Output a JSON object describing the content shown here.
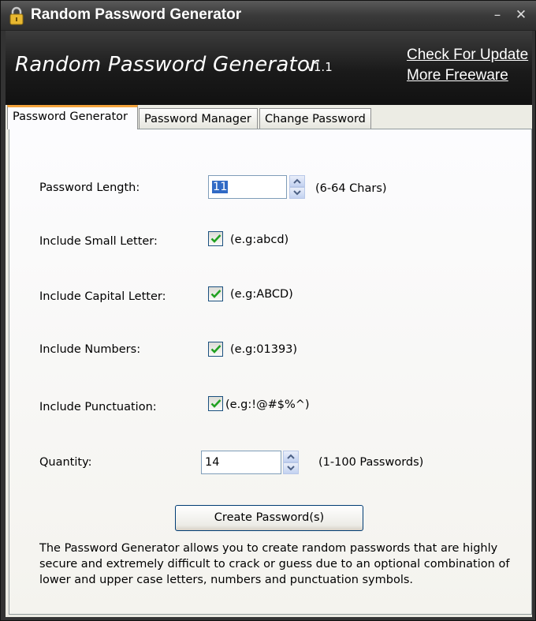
{
  "window": {
    "title": "Random Password Generator"
  },
  "banner": {
    "title": "Random Password Generator",
    "version": "v1.1",
    "links": {
      "check_update": "Check For Update",
      "more_freeware": "More Freeware"
    }
  },
  "tabs": [
    {
      "label": "Password Generator",
      "active": true
    },
    {
      "label": "Password Manager",
      "active": false
    },
    {
      "label": "Change Password",
      "active": false
    }
  ],
  "form": {
    "length": {
      "label": "Password Length:",
      "value": "11",
      "hint": "(6-64 Chars)"
    },
    "small": {
      "label": "Include Small Letter:",
      "checked": true,
      "hint": "(e.g:abcd)"
    },
    "capital": {
      "label": "Include Capital Letter:",
      "checked": true,
      "hint": "(e.g:ABCD)"
    },
    "numbers": {
      "label": "Include Numbers:",
      "checked": true,
      "hint": "(e.g:01393)"
    },
    "punctuation": {
      "label": "Include Punctuation:",
      "checked": true,
      "hint": "(e.g:!@#$%^)"
    },
    "quantity": {
      "label": "Quantity:",
      "value": "14",
      "hint": "(1-100 Passwords)"
    },
    "create_label": "Create Password(s)"
  },
  "description": "The Password Generator allows you to create random passwords that are highly secure and extremely difficult to crack or guess due to an optional combination of lower and upper case letters, numbers and punctuation symbols.",
  "icons": {
    "lock": "lock-icon",
    "minimize": "minimize-icon",
    "close": "close-icon",
    "check": "check-icon",
    "spin_up": "arrow-up-icon",
    "spin_down": "arrow-down-icon"
  },
  "colors": {
    "active_tab_accent": "#f3a33b",
    "check_mark": "#21a121",
    "selection": "#316ac5"
  }
}
